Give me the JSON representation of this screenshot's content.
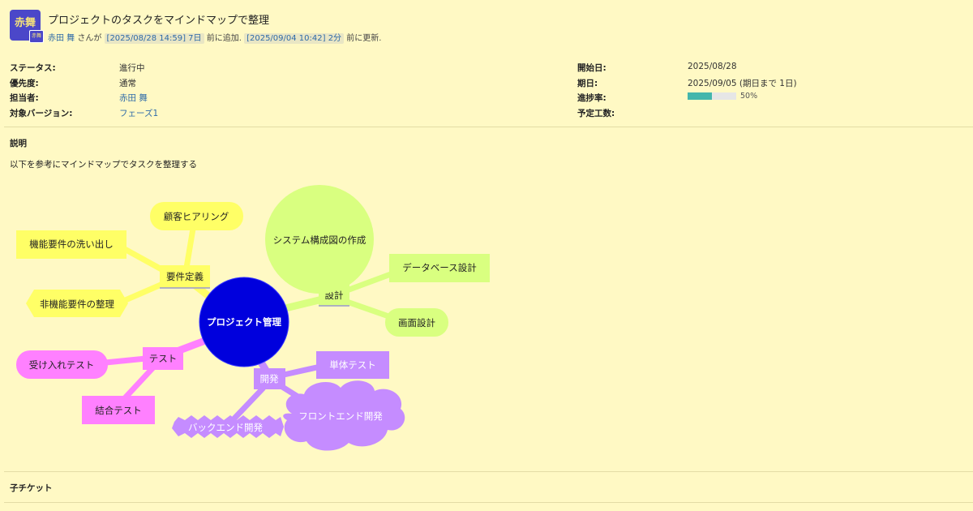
{
  "header": {
    "avatar_initials": "赤舞",
    "avatar_small_text": "赤舞",
    "title": "プロジェクトのタスクをマインドマップで整理",
    "author": "赤田 舞",
    "san_ga": " さんが ",
    "created_ts": "[2025/08/28 14:59] 7日",
    "created_suffix": " 前に追加. ",
    "updated_ts": "[2025/09/04 10:42] 2分",
    "updated_suffix": " 前に更新."
  },
  "attributes": {
    "status_label": "ステータス:",
    "status_value": "進行中",
    "priority_label": "優先度:",
    "priority_value": "通常",
    "assignee_label": "担当者:",
    "assignee_value": "赤田 舞",
    "version_label": "対象バージョン:",
    "version_value": "フェーズ1",
    "start_label": "開始日:",
    "start_value": "2025/08/28",
    "due_label": "期日:",
    "due_value": "2025/09/05 (期日まで 1日)",
    "progress_label": "進捗率:",
    "progress_value": "50%",
    "progress_fraction": 0.5,
    "estimate_label": "予定工数:"
  },
  "description": {
    "title": "説明",
    "text": "以下を参考にマインドマップでタスクを整理する"
  },
  "mindmap": {
    "center": "プロジェクト管理",
    "branches": {
      "req": {
        "label": "要件定義",
        "color": "#ffff66",
        "children": [
          "顧客ヒアリング",
          "機能要件の洗い出し",
          "非機能要件の整理"
        ]
      },
      "design": {
        "label": "設計",
        "color": "#d9ff80",
        "children": [
          "システム構成図の作成",
          "データベース設計",
          "画面設計"
        ]
      },
      "test": {
        "label": "テスト",
        "color": "#ff80ff",
        "children": [
          "受け入れテスト",
          "結合テスト"
        ]
      },
      "dev": {
        "label": "開発",
        "color": "#c58cff",
        "children": [
          "単体テスト",
          "フロントエンド開発",
          "バックエンド開発"
        ]
      }
    },
    "center_color": "#0000dd"
  },
  "subtickets": {
    "title": "子チケット"
  }
}
